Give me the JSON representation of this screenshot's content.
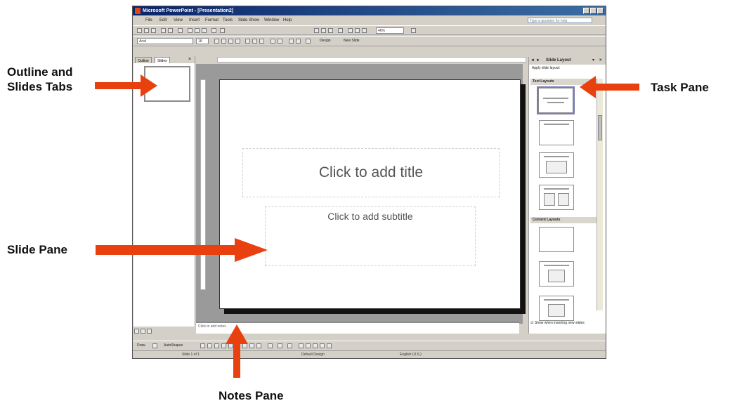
{
  "colors": {
    "arrow": "#e8410f",
    "titlebar": "#0a246a",
    "slide_shadow": "#111111"
  },
  "callouts": {
    "outline_tabs_line1": "Outline and",
    "outline_tabs_line2": "Slides Tabs",
    "task_pane": "Task Pane",
    "slide_pane": "Slide Pane",
    "notes_pane": "Notes Pane"
  },
  "window": {
    "title": "Microsoft PowerPoint - [Presentation2]",
    "menus": [
      "File",
      "Edit",
      "View",
      "Insert",
      "Format",
      "Tools",
      "Slide Show",
      "Window",
      "Help"
    ],
    "ask_placeholder": "Type a question for help",
    "zoom": "46%",
    "font_name": "Arial",
    "font_size": "18",
    "design_button": "Design",
    "new_slide_button": "New Slide"
  },
  "left_pane": {
    "tab_outline": "Outline",
    "tab_slides": "Slides"
  },
  "slide": {
    "title_placeholder": "Click to add title",
    "subtitle_placeholder": "Click to add subtitle"
  },
  "notes": {
    "placeholder": "Click to add notes"
  },
  "drawing_toolbar": {
    "draw_menu": "Draw",
    "autoshapes_menu": "AutoShapes"
  },
  "status_bar": {
    "slide_count": "Slide 1 of 1",
    "design": "Default Design",
    "language": "English (U.S.)"
  },
  "task_pane": {
    "title": "Slide Layout",
    "apply_label": "Apply slide layout:",
    "section_text": "Text Layouts",
    "section_content": "Content Layouts",
    "footer_checkbox": "Show when inserting new slides"
  }
}
